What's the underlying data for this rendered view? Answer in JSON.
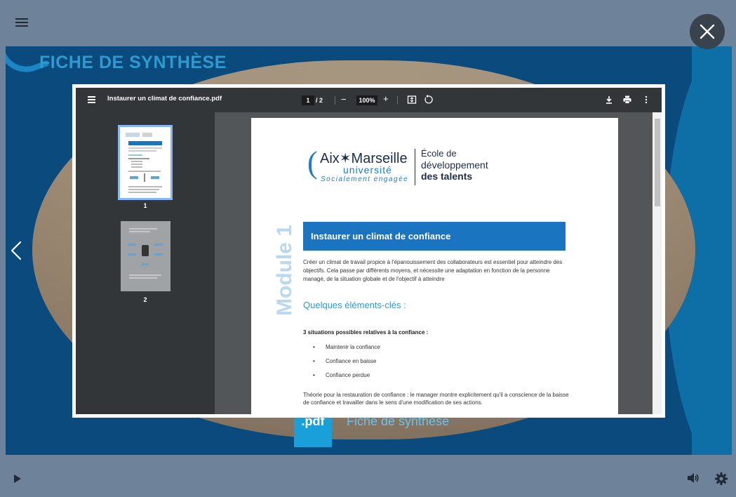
{
  "player": {
    "menu_icon": "hamburger-icon",
    "close_icon": "close-icon",
    "prev_icon": "chevron-left-icon",
    "play_icon": "play-icon",
    "volume_icon": "volume-icon",
    "settings_icon": "gear-icon"
  },
  "slide": {
    "title": "FICHE DE SYNTHÈSE",
    "file_badge": ".pdf",
    "file_label": "Fiche de synthèse"
  },
  "pdf_viewer": {
    "filename": "Instaurer un climat de confiance.pdf",
    "current_page": "1",
    "total_pages": "/ 2",
    "zoom": "100%",
    "thumbnails": [
      {
        "label": "1"
      },
      {
        "label": "2"
      }
    ]
  },
  "document": {
    "logo_main": "Aix✶Marseille",
    "logo_univ": "université",
    "logo_tagline": "Socialement engagée",
    "school_line1": "École de",
    "school_line2": "développement",
    "school_line3": "des talents",
    "module": "Module 1",
    "banner_title": "Instaurer un climat de confiance",
    "intro": "Créer un climat de travail propice à l'épanouissement des collaborateurs est essentiel pour atteindre des objectifs. Cela passe par différents moyens, et nécessite une adaptation en fonction de la personne managé, de la situation globale et de l'objectif à atteindre",
    "section_heading": "Quelques éléments-clés :",
    "situations_heading": "3 situations possibles relatives à la confiance :",
    "situations": [
      "Maintenir la confiance",
      "Confiance en baisse",
      "Confiance perdue"
    ],
    "theory": "Théorie pour la restauration de confiance : le manager montre explicitement qu'il a conscience de la baisse de confiance et travailler dans le sens d'une modification de ses actions."
  },
  "colors": {
    "player_bg": "#6e8399",
    "stage_bg": "#0a4a7d",
    "accent": "#2e9ad0",
    "banner": "#1a74bf",
    "pdf_toolbar": "#323639"
  }
}
